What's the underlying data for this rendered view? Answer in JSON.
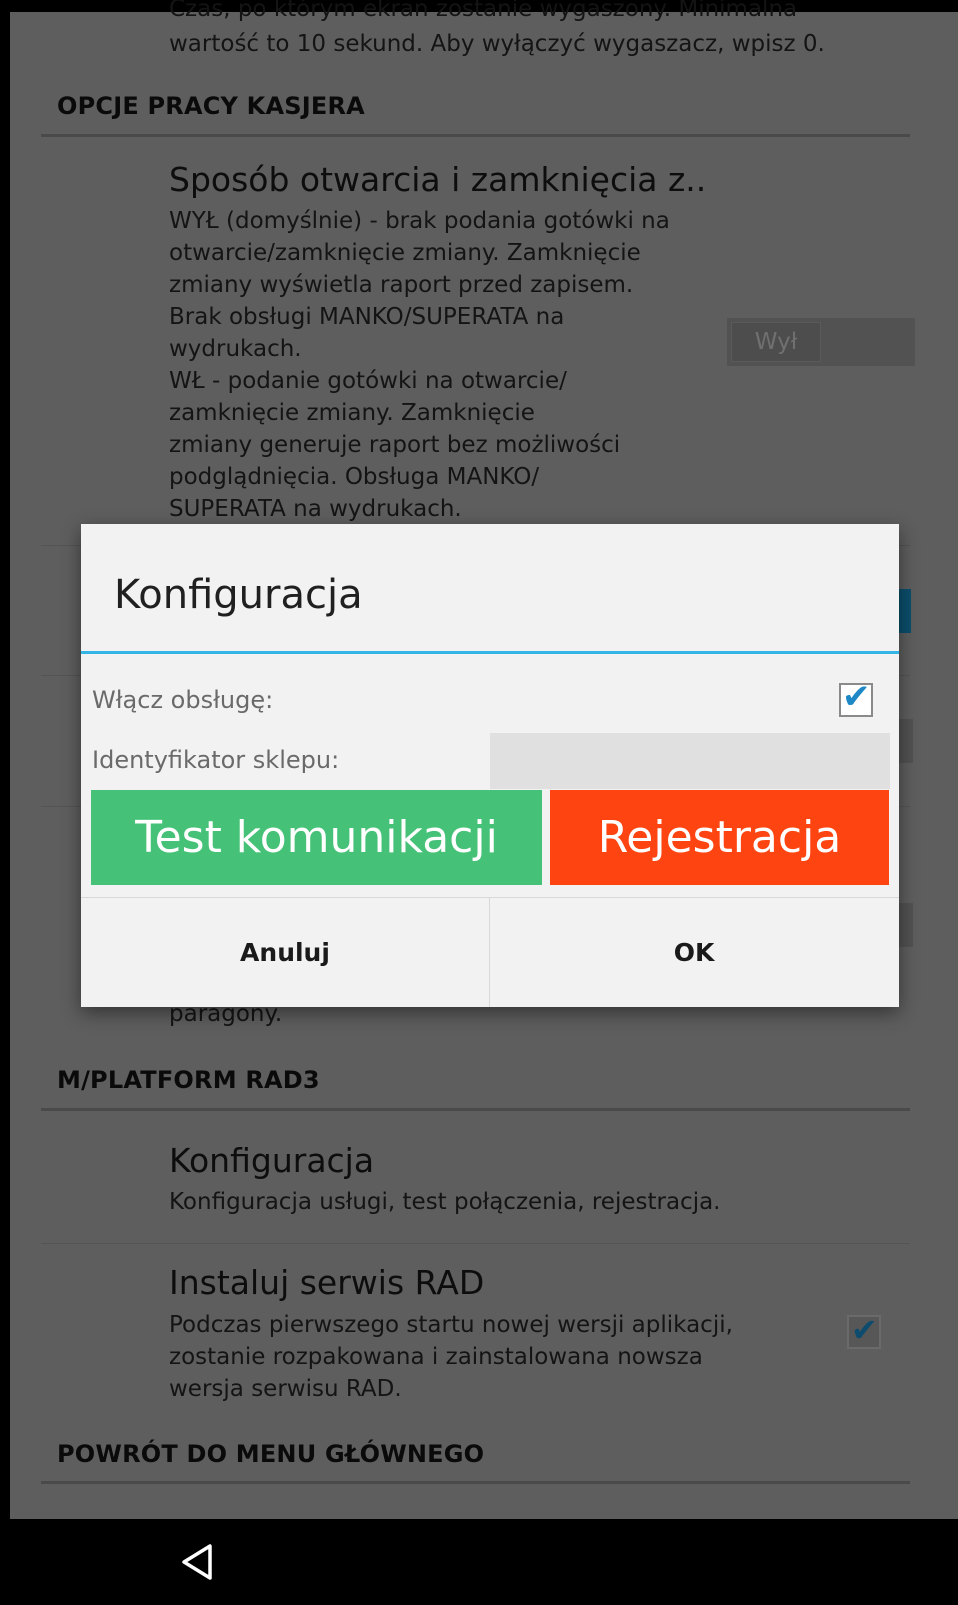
{
  "background": {
    "top_summary_line1": "Czas, po którym ekran zostanie wygaszony. Minimalna",
    "top_summary_line2": "wartość to 10 sekund. Aby wyłączyć wygaszacz, wpisz 0.",
    "section_cashier": "OPCJE PRACY KASJERA",
    "shift_title": "Sposób otwarcia i zamknięcia z..",
    "shift_summary": "WYŁ (domyślnie) - brak podania gotówki na\notwarcie/zamknięcie zmiany. Zamknięcie\nzmiany wyświetla raport przed zapisem.\nBrak obsługi MANKO/SUPERATA na\nwydrukach.\nWŁ - podanie gotówki na otwarcie/\nzamknięcie zmiany. Zamknięcie\nzmiany generuje raport bez możliwości\npodglądnięcia. Obsługa MANKO/\nSUPERATA na wydrukach.",
    "shift_switch_label": "Wył",
    "partial_text": "paragony.",
    "section_platform": "M/PLATFORM RAD3",
    "config_title": "Konfiguracja",
    "config_summary": "Konfiguracja usługi, test połączenia, rejestracja.",
    "rad_title": "Instaluj serwis RAD",
    "rad_summary": "Podczas pierwszego startu nowej wersji aplikacji,\nzostanie rozpakowana i zainstalowana nowsza\nwersja serwisu RAD.",
    "rad_checked": true,
    "section_menu": "POWRÓT DO MENU GŁÓWNEGO"
  },
  "dialog": {
    "title": "Konfiguracja",
    "enable_label": "Włącz obsługę:",
    "enable_checked": true,
    "store_id_label": "Identyfikator sklepu:",
    "store_id_value": "",
    "test_button": "Test komunikacji",
    "register_button": "Rejestracja",
    "cancel_button": "Anuluj",
    "ok_button": "OK"
  },
  "colors": {
    "accent": "#33b5e5",
    "test_button": "#45c277",
    "register_button": "#fe4511",
    "check": "#1e88c6"
  },
  "navbar": {
    "back_icon": "back-triangle-icon"
  }
}
